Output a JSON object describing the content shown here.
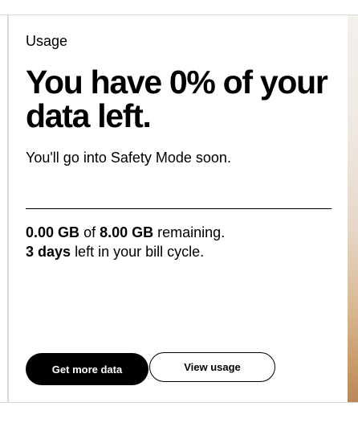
{
  "usage_card": {
    "label": "Usage",
    "headline": "You have 0% of your data left.",
    "subtext": "You'll go into Safety Mode soon.",
    "stats": {
      "used": "0.00 GB",
      "of_word": "of",
      "total": "8.00 GB",
      "remaining_word": "remaining.",
      "days": "3 days",
      "days_suffix": "left in your bill cycle."
    },
    "data_left_percent": 0,
    "buttons": {
      "primary_label": "Get more data",
      "secondary_label": "View usage"
    }
  },
  "colors": {
    "primary_button_bg": "#000000",
    "primary_button_text": "#ffffff",
    "divider": "#d8dada"
  }
}
